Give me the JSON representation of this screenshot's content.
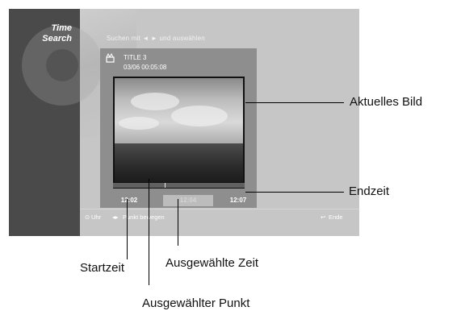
{
  "sidebar": {
    "title": "Time\nSearch"
  },
  "instruction": "Suchen mit ◄ ► und auswählen",
  "panel": {
    "title_name": "TITLE 3",
    "title_info": "03/06  00:05:08",
    "times": {
      "start": "12:02",
      "selected": "12:04",
      "end": "12:07"
    }
  },
  "bottom_bar": {
    "clock": "Uhr",
    "move": "Punkt bewegen",
    "end": "Ende",
    "clock_icon": "clock-icon",
    "arrows_icon": "left-right-arrows-icon",
    "return_icon": "return-icon"
  },
  "callouts": {
    "current_image": "Aktuelles Bild",
    "end_time": "Endzeit",
    "start_time": "Startzeit",
    "selected_time": "Ausgewählte Zeit",
    "selected_point": "Ausgewählter Punkt"
  },
  "colors": {
    "screen_bg": "#c6c6c6",
    "sidebar_bg": "#4a4a4a",
    "panel_bg": "#8e8e8e"
  }
}
